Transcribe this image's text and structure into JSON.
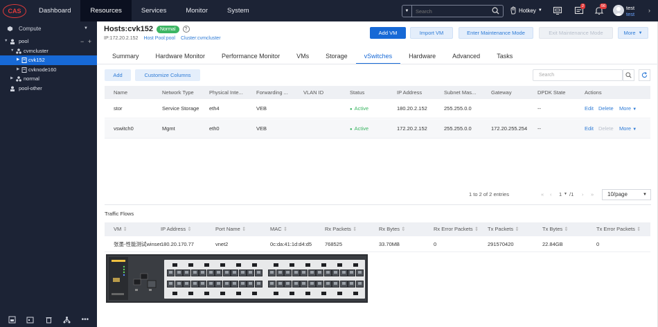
{
  "app": {
    "logo": "CAS"
  },
  "nav": [
    {
      "label": "Dashboard",
      "active": false
    },
    {
      "label": "Resources",
      "active": true
    },
    {
      "label": "Services",
      "active": false
    },
    {
      "label": "Monitor",
      "active": false
    },
    {
      "label": "System",
      "active": false
    }
  ],
  "topbar": {
    "search_placeholder": "Search",
    "hotkey": "Hotkey",
    "alarm_badge": "2",
    "bell_badge": "56",
    "user_name": "test",
    "user_role": "test"
  },
  "sidebar": {
    "header": "Compute",
    "tree": [
      {
        "label": "pool",
        "level": 0,
        "expanded": true,
        "icon": "pool-icon"
      },
      {
        "label": "cvmcluster",
        "level": 1,
        "expanded": true,
        "icon": "cluster-icon"
      },
      {
        "label": "cvk152",
        "level": 2,
        "expanded": false,
        "icon": "host-icon",
        "selected": true
      },
      {
        "label": "cvknode160",
        "level": 2,
        "expanded": false,
        "icon": "host-icon"
      },
      {
        "label": "normal",
        "level": 1,
        "expanded": false,
        "icon": "cluster-icon"
      },
      {
        "label": "pool-other",
        "level": 0,
        "expanded": null,
        "icon": "pool-icon"
      }
    ]
  },
  "host": {
    "title": "Hosts:cvk152",
    "status": "Normal",
    "ip": "IP:172.20.2.152",
    "host_pool": "Host Pool:pool",
    "cluster": "Cluster:cvmcluster"
  },
  "actions": {
    "add_vm": "Add VM",
    "import_vm": "Import VM",
    "enter_maint": "Enter Maintenance Mode",
    "exit_maint": "Exit Maintenance Mode",
    "more": "More"
  },
  "tabs": [
    {
      "label": "Summary",
      "active": false
    },
    {
      "label": "Hardware Monitor",
      "active": false
    },
    {
      "label": "Performance Monitor",
      "active": false
    },
    {
      "label": "VMs",
      "active": false
    },
    {
      "label": "Storage",
      "active": false
    },
    {
      "label": "vSwitches",
      "active": true
    },
    {
      "label": "Hardware",
      "active": false
    },
    {
      "label": "Advanced",
      "active": false
    },
    {
      "label": "Tasks",
      "active": false
    }
  ],
  "toolbar": {
    "add": "Add",
    "customize": "Customize Columns",
    "search_placeholder": "Search"
  },
  "vswitch_table": {
    "columns": [
      "Name",
      "Network Type",
      "Physical Inte...",
      "Forwarding ...",
      "VLAN ID",
      "Status",
      "IP Address",
      "Subnet Mas...",
      "Gateway",
      "DPDK State",
      "Actions"
    ],
    "rows": [
      {
        "name": "stor",
        "network_type": "Service Storage",
        "physical": "eth4",
        "forwarding": "VEB",
        "vlan": "",
        "status": "Active",
        "ip": "180.20.2.152",
        "subnet": "255.255.0.0",
        "gateway": "",
        "dpdk": "--",
        "edit": "Edit",
        "delete": "Delete",
        "more": "More",
        "delete_disabled": false
      },
      {
        "name": "vswitch0",
        "network_type": "Mgmt",
        "physical": "eth0",
        "forwarding": "VEB",
        "vlan": "",
        "status": "Active",
        "ip": "172.20.2.152",
        "subnet": "255.255.0.0",
        "gateway": "172.20.255.254",
        "dpdk": "--",
        "edit": "Edit",
        "delete": "Delete",
        "more": "More",
        "delete_disabled": true
      }
    ]
  },
  "pagination": {
    "summary": "1 to 2 of 2 entries",
    "page": "1",
    "total": "/1",
    "page_size": "10/page"
  },
  "traffic": {
    "title": "Traffic Flows",
    "columns": [
      "VM",
      "IP Address",
      "Port Name",
      "MAC",
      "Rx Packets",
      "Rx Bytes",
      "Rx Error Packets",
      "Tx Packets",
      "Tx Bytes",
      "Tx Error Packets"
    ],
    "rows": [
      {
        "vm": "张墨-性能测试winser",
        "ip": "180.20.170.77",
        "port": "vnet2",
        "mac": "0c:da:41:1d:d4:d5",
        "rx_packets": "768525",
        "rx_bytes": "33.70MB",
        "rx_err": "0",
        "tx_packets": "291570420",
        "tx_bytes": "22.84GB",
        "tx_err": "0"
      }
    ]
  },
  "colors": {
    "accent": "#1769d6",
    "topbar": "#1c2335",
    "active": "#3cb563"
  }
}
